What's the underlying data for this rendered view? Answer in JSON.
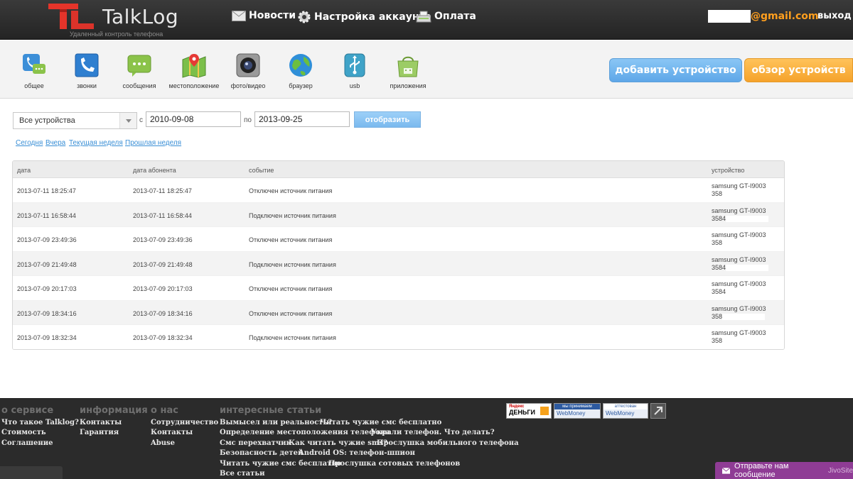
{
  "header": {
    "brand": "TalkLog",
    "tagline": "Удаленный контроль телефона",
    "nav": [
      {
        "label": "Новости",
        "icon": "envelope-icon"
      },
      {
        "label": "Настройка аккаунта",
        "icon": "gear-icon"
      },
      {
        "label": "Оплата",
        "icon": "cash-register-icon"
      }
    ],
    "email_suffix": "@gmail.com",
    "logout": "выход"
  },
  "toolbar": {
    "tools": [
      {
        "label": "общее",
        "icon": "general-icon"
      },
      {
        "label": "звонки",
        "icon": "phone-icon"
      },
      {
        "label": "сообщения",
        "icon": "messages-icon"
      },
      {
        "label": "местоположение",
        "icon": "map-icon"
      },
      {
        "label": "фото/видео",
        "icon": "camera-icon"
      },
      {
        "label": "браузер",
        "icon": "globe-icon"
      },
      {
        "label": "usb",
        "icon": "usb-icon"
      },
      {
        "label": "приложения",
        "icon": "android-market-icon"
      }
    ],
    "add_device": "добавить устройство",
    "review_devices": "обзор устройств"
  },
  "filter": {
    "device_select": "Все устройства",
    "from_label": "с",
    "from_value": "2010-09-08",
    "to_label": "по",
    "to_value": "2013-09-25",
    "show_button": "отобразить",
    "quick_links": [
      "Сегодня",
      "Вчера",
      "Текущая неделя",
      "Прошлая неделя"
    ]
  },
  "table": {
    "columns": [
      "дата",
      "дата абонента",
      "событие",
      "устройство"
    ],
    "rows": [
      {
        "date": "2013-07-11 18:25:47",
        "sub_date": "2013-07-11 18:25:47",
        "event": "Отключен источник питания",
        "device": "samsung GT-I9003",
        "id": "358"
      },
      {
        "date": "2013-07-11 16:58:44",
        "sub_date": "2013-07-11 16:58:44",
        "event": "Подключен источник питания",
        "device": "samsung GT-I9003",
        "id": "3584"
      },
      {
        "date": "2013-07-09 23:49:36",
        "sub_date": "2013-07-09 23:49:36",
        "event": "Отключен источник питания",
        "device": "samsung GT-I9003",
        "id": "358"
      },
      {
        "date": "2013-07-09 21:49:48",
        "sub_date": "2013-07-09 21:49:48",
        "event": "Подключен источник питания",
        "device": "samsung GT-I9003",
        "id": "3584"
      },
      {
        "date": "2013-07-09 20:17:03",
        "sub_date": "2013-07-09 20:17:03",
        "event": "Отключен источник питания",
        "device": "samsung GT-I9003",
        "id": "3584"
      },
      {
        "date": "2013-07-09 18:34:16",
        "sub_date": "2013-07-09 18:34:16",
        "event": "Отключен источник питания",
        "device": "samsung GT-I9003",
        "id": "358"
      },
      {
        "date": "2013-07-09 18:32:34",
        "sub_date": "2013-07-09 18:32:34",
        "event": "Подключен источник питания",
        "device": "samsung GT-I9003",
        "id": "358"
      }
    ]
  },
  "footer": {
    "sections": [
      {
        "title": "о сервисе",
        "links": [
          "Что такое Talklog?",
          "Стоимость",
          "Соглашение"
        ]
      },
      {
        "title": "информация",
        "links": [
          "Контакты",
          "Гарантия"
        ]
      },
      {
        "title": "о нас",
        "links": [
          "Сотрудничество",
          "Контакты",
          "Abuse"
        ]
      },
      {
        "title": "интересные статьи"
      }
    ],
    "articles": [
      [
        "Вымысел или реальность?",
        "Читать чужие смс бесплатно"
      ],
      [
        "Определение местоположения телефона",
        "Украли телефон. Что делать?"
      ],
      [
        "Смс перехватчик",
        "Как читать чужие sms?",
        "Прослушка мобильного телефона"
      ],
      [
        "Безопасность детей",
        "Android OS: телефон-шпион"
      ],
      [
        "Читать чужие смс бесплатно",
        "Прослушка сотовых телефонов"
      ],
      [
        "Все статьи"
      ]
    ],
    "badges": {
      "yandex_top": "Яндекс",
      "yandex_main": "ДЕНЬГИ",
      "wm1_top": "мы принимаем",
      "wm1_main": "WebMoney",
      "wm2_top": "аттестован",
      "wm2_main": "WebMoney"
    }
  },
  "chat": {
    "label": "Отправьте нам сообщение",
    "brand": "JivoSite"
  }
}
